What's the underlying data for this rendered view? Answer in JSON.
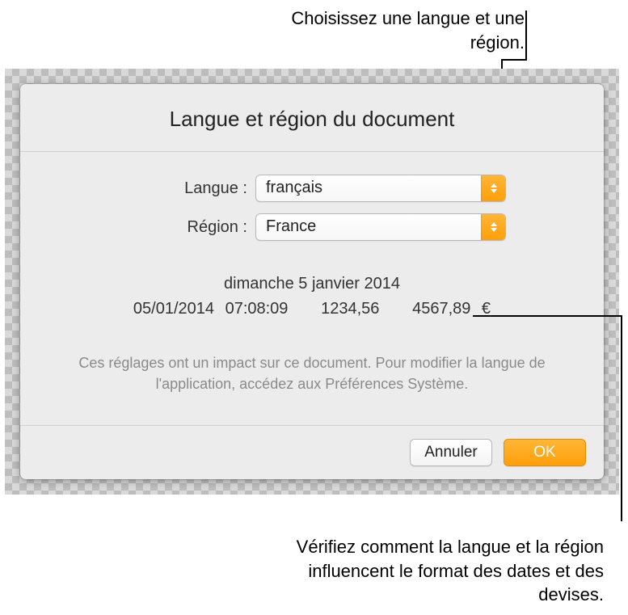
{
  "callouts": {
    "top": "Choisissez une langue et une région.",
    "bottom": "Vérifiez comment la langue et la région influencent le format des dates et des devises."
  },
  "dialog": {
    "title": "Langue et région du document",
    "language_label": "Langue :",
    "language_value": "français",
    "region_label": "Région :",
    "region_value": "France",
    "preview": {
      "long_date": "dimanche 5 janvier 2014",
      "short_datetime": "05/01/2014 07:08:09",
      "number": "1234,56",
      "currency": "4567,89 €"
    },
    "hint": "Ces réglages ont un impact sur ce document. Pour modifier la langue de l'application, accédez aux Préférences Système.",
    "cancel": "Annuler",
    "ok": "OK"
  }
}
